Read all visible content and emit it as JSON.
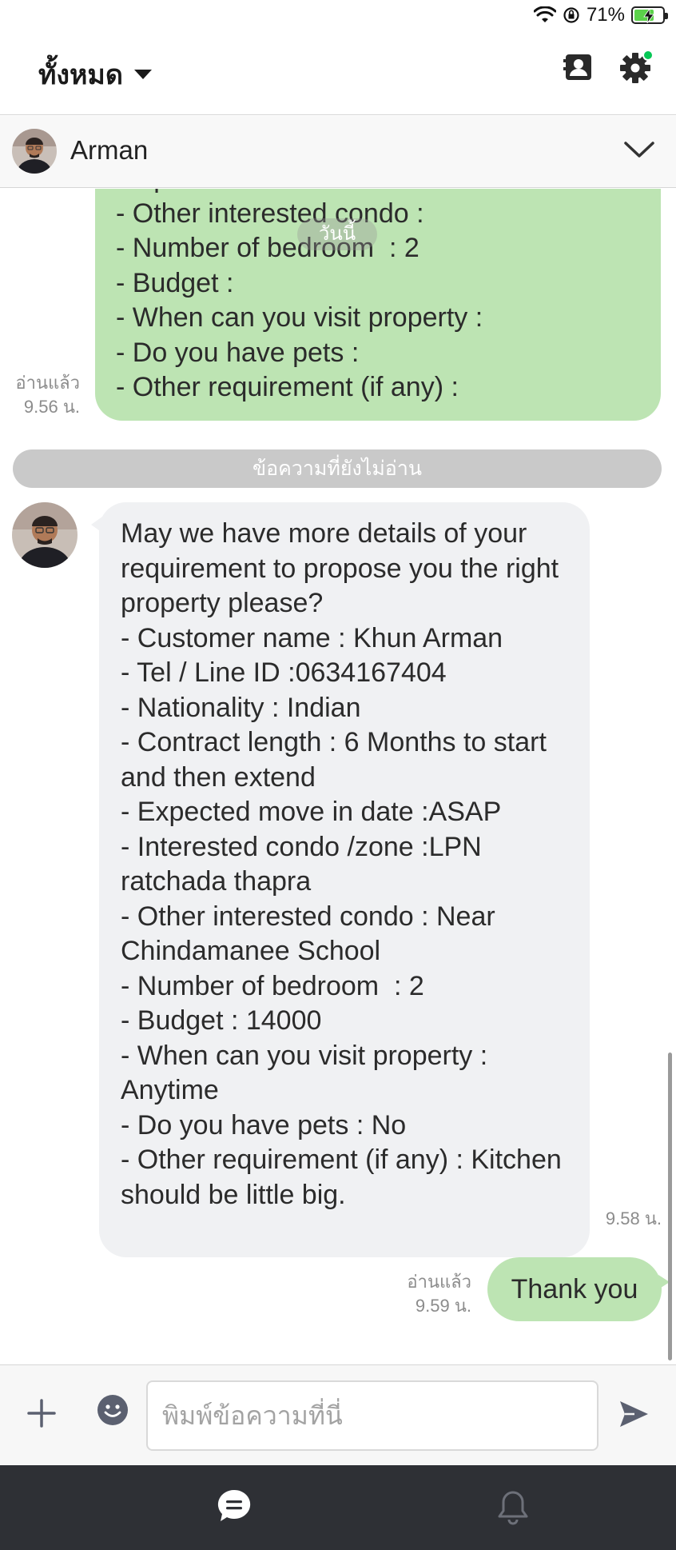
{
  "status_bar": {
    "battery_text": "71%",
    "battery_level": 0.71,
    "wifi_icon": "wifi-icon",
    "rotation_lock_icon": "rotation-lock-icon"
  },
  "header": {
    "filter_label": "ทั้งหมด",
    "icons": [
      "contacts-icon",
      "settings-icon"
    ],
    "notification_dot_color": "#06c755"
  },
  "contact": {
    "name": "Arman"
  },
  "chat": {
    "date_separator": "วันนี้",
    "unread_divider": "ข้อความที่ยังไม่อ่าน",
    "messages": [
      {
        "side": "outgoing",
        "text": "thapra\n- Other interested condo :\n- Number of bedroom  : 2\n- Budget :\n- When can you visit property :\n- Do you have pets :\n- Other requirement (if any) :",
        "read_label": "อ่านแล้ว",
        "time": "9.56 น."
      },
      {
        "side": "incoming",
        "text": "May we have more details of your requirement to propose you the right property please?\n- Customer name : Khun Arman\n- Tel / Line ID :0634167404\n- Nationality : Indian\n- Contract length : 6 Months to start and then extend\n- Expected move in date :ASAP\n- Interested condo /zone :LPN ratchada thapra\n- Other interested condo : Near Chindamanee School\n- Number of bedroom  : 2\n- Budget : 14000\n- When can you visit property : Anytime\n- Do you have pets : No\n- Other requirement (if any) : Kitchen should be little big.",
        "time": "9.58 น."
      },
      {
        "side": "outgoing",
        "text": "Thank you",
        "read_label": "อ่านแล้ว",
        "time": "9.59 น."
      }
    ]
  },
  "composer": {
    "placeholder": "พิมพ์ข้อความที่นี่"
  },
  "colors": {
    "outgoing_bubble": "#bde4b3",
    "incoming_bubble": "#f0f1f3",
    "accent": "#06c755",
    "bottom_nav": "#2e3035"
  }
}
